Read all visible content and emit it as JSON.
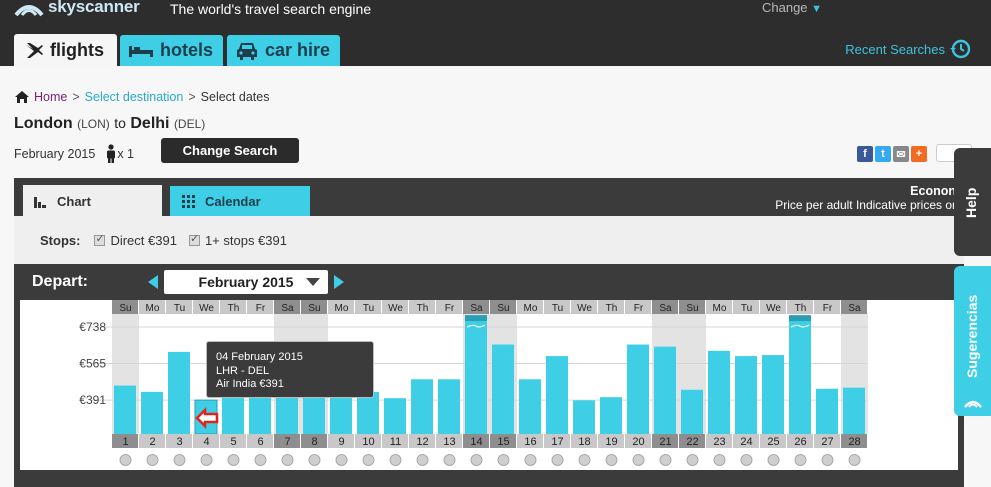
{
  "header": {
    "brand": "skyscanner",
    "tagline": "The world's travel search engine",
    "change_label": "Change",
    "tabs": [
      {
        "label": "flights",
        "icon": "plane-icon",
        "active": true
      },
      {
        "label": "hotels",
        "icon": "bed-icon",
        "active": false
      },
      {
        "label": "car hire",
        "icon": "car-icon",
        "active": false
      }
    ],
    "recent_searches": "Recent Searches"
  },
  "breadcrumb": {
    "home": "Home",
    "select_destination": "Select destination",
    "current": "Select dates",
    "separator": ">"
  },
  "route": {
    "origin": "London",
    "origin_code": "(LON)",
    "to": "to",
    "destination": "Delhi",
    "destination_code": "(DEL)"
  },
  "search": {
    "month": "February 2015",
    "passengers": "x 1",
    "change_search": "Change Search"
  },
  "panel": {
    "tabs": [
      "Chart",
      "Calendar"
    ],
    "cabin": "Econon",
    "price_note": "Price per adult Indicative prices or",
    "stops_label": "Stops:",
    "stops": [
      {
        "label": "Direct €391",
        "checked": true
      },
      {
        "label": "1+ stops €391",
        "checked": true
      }
    ],
    "depart_label": "Depart:",
    "selected_month": "February 2015"
  },
  "tooltip": {
    "date": "04 February 2015",
    "route": "LHR - DEL",
    "carrier_price": "Air India €391"
  },
  "side": {
    "help": "Help",
    "suggestions": "Sugerencias"
  },
  "colors": {
    "accent": "#3ecfe6",
    "dark": "#3b3b3b",
    "weekend_col": "#e3e3e3",
    "weekend_label": "#8e8e8e",
    "weekday_label": "#c8c8c8"
  },
  "chart_data": {
    "type": "bar",
    "title": "",
    "xlabel": "",
    "ylabel": "",
    "y_ticks": [
      "€738",
      "€565",
      "€391"
    ],
    "y_tick_values": [
      738,
      565,
      391
    ],
    "ylim": [
      230,
      800
    ],
    "categories": [
      "1",
      "2",
      "3",
      "4",
      "5",
      "6",
      "7",
      "8",
      "9",
      "10",
      "11",
      "12",
      "13",
      "14",
      "15",
      "16",
      "17",
      "18",
      "19",
      "20",
      "21",
      "22",
      "23",
      "24",
      "25",
      "26",
      "27",
      "28"
    ],
    "weekdays": [
      "Su",
      "Mo",
      "Tu",
      "We",
      "Th",
      "Fr",
      "Sa",
      "Su",
      "Mo",
      "Tu",
      "We",
      "Th",
      "Fr",
      "Sa",
      "Su",
      "Mo",
      "Tu",
      "We",
      "Th",
      "Fr",
      "Sa",
      "Su",
      "Mo",
      "Tu",
      "We",
      "Th",
      "Fr",
      "Sa"
    ],
    "values": [
      460,
      430,
      620,
      391,
      430,
      460,
      470,
      430,
      430,
      430,
      400,
      490,
      490,
      790,
      655,
      490,
      600,
      390,
      405,
      655,
      645,
      440,
      625,
      600,
      605,
      790,
      445,
      450
    ],
    "capped_days": [
      "14",
      "26"
    ],
    "selected_day": "4"
  }
}
